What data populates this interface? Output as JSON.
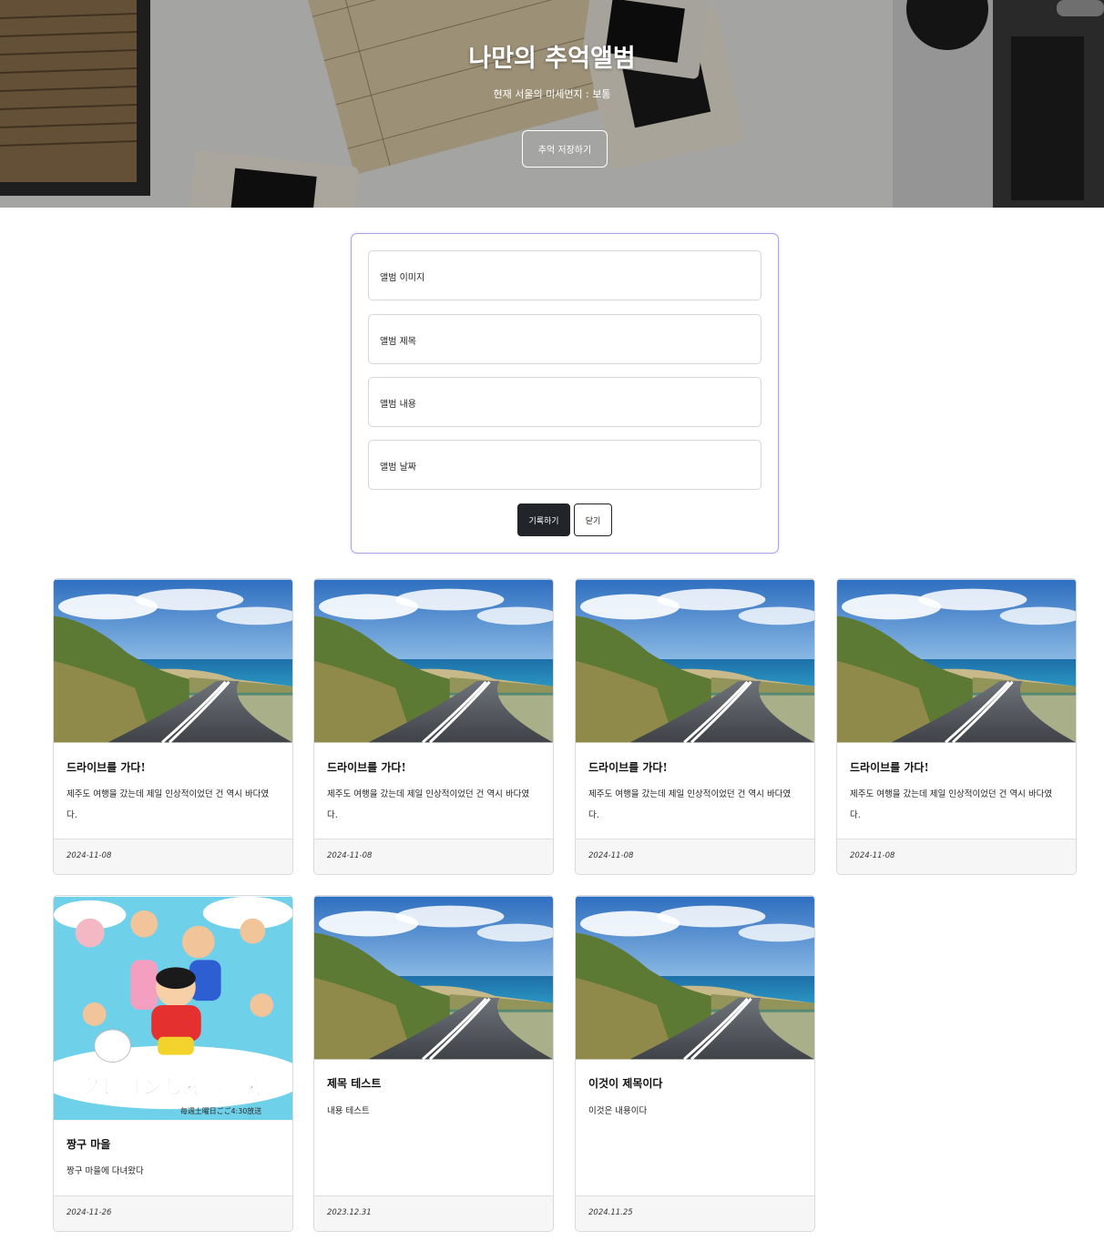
{
  "hero": {
    "title": "나만의 추억앨범",
    "subtitle": "현재 서울의 미세먼지 : 보통",
    "button_label": "추억 저장하기"
  },
  "form": {
    "fields": [
      {
        "placeholder": "앨범 이미지"
      },
      {
        "placeholder": "앨범 제목"
      },
      {
        "placeholder": "앨범 내용"
      },
      {
        "placeholder": "앨범 날짜"
      }
    ],
    "submit_label": "기록하기",
    "close_label": "닫기"
  },
  "cards": [
    {
      "image": "coastal-road-photo",
      "title": "드라이브를 가다!",
      "text": "제주도 여행을 갔는데 제일 인상적이었던 건 역시 바다였다.",
      "date": "2024-11-08"
    },
    {
      "image": "coastal-road-photo",
      "title": "드라이브를 가다!",
      "text": "제주도 여행을 갔는데 제일 인상적이었던 건 역시 바다였다.",
      "date": "2024-11-08"
    },
    {
      "image": "coastal-road-photo",
      "title": "드라이브를 가다!",
      "text": "제주도 여행을 갔는데 제일 인상적이었던 건 역시 바다였다.",
      "date": "2024-11-08"
    },
    {
      "image": "coastal-road-photo",
      "title": "드라이브를 가다!",
      "text": "제주도 여행을 갔는데 제일 인상적이었던 건 역시 바다였다.",
      "date": "2024-11-08"
    },
    {
      "image": "crayon-shinchan-poster",
      "title": "짱구 마을",
      "text": "짱구 마을에 다녀왔다",
      "date": "2024-11-26",
      "poster_text": "クレヨンしんちゃん",
      "poster_caption": "毎週土曜日ごご4:30放送"
    },
    {
      "image": "coastal-road-photo",
      "title": "제목 테스트",
      "text": "내용 테스트",
      "date": "2023.12.31"
    },
    {
      "image": "coastal-road-photo",
      "title": "이것이 제목이다",
      "text": "이것은 내용이다",
      "date": "2024.11.25"
    }
  ]
}
